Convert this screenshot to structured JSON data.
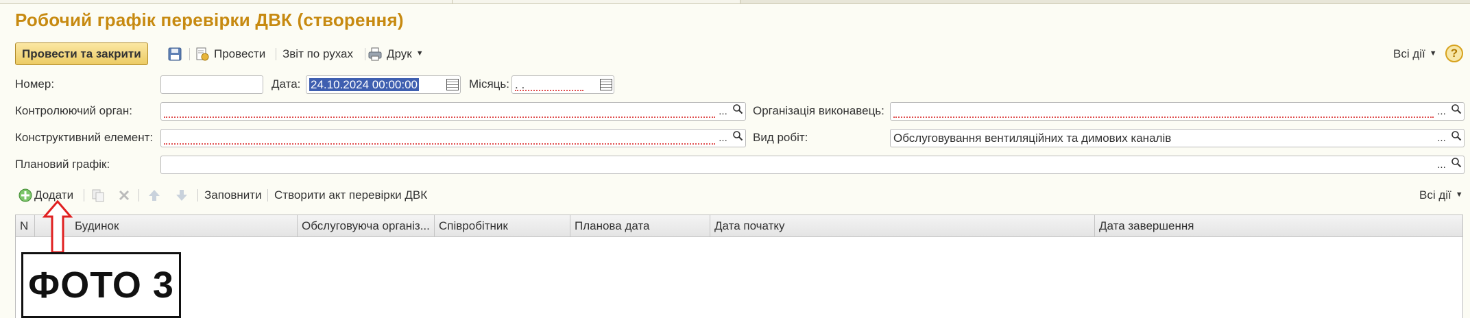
{
  "window": {
    "title": "Робочий графік перевірки ДВК (створення)"
  },
  "toolbar": {
    "post_close_label": "Провести та закрити",
    "save_icon": "floppy-icon",
    "post_label": "Провести",
    "report_label": "Звіт по рухах",
    "print_label": "Друк",
    "all_actions_label": "Всі дії",
    "help_label": "?"
  },
  "form": {
    "number_label": "Номер:",
    "number_value": "",
    "date_label": "Дата:",
    "date_value": "24.10.2024 00:00:00",
    "month_label": "Місяць:",
    "month_value": "  .  .",
    "control_body_label": "Контролюючий орган:",
    "control_body_value": "",
    "executor_org_label": "Організація виконавець:",
    "executor_org_value": "",
    "constructive_element_label": "Конструктивний елемент:",
    "constructive_element_value": "",
    "work_type_label": "Вид робіт:",
    "work_type_value": "Обслуговування вентиляційних та димових каналів",
    "planned_schedule_label": "Плановий графік:",
    "planned_schedule_value": "",
    "select_button": "...",
    "search_icon": "magnifier-icon"
  },
  "table_toolbar": {
    "add_label": "Додати",
    "fill_label": "Заповнити",
    "create_act_label": "Створити акт перевірки ДВК",
    "all_actions_label": "Всі дії"
  },
  "table": {
    "columns": [
      "N",
      "Будинок",
      "Обслуговуюча організ...",
      "Співробітник",
      "Планова дата",
      "Дата початку",
      "Дата завершення"
    ],
    "rows": []
  },
  "annotation": {
    "label": "ФОТО 3",
    "arrow_color": "#e02020"
  },
  "colors": {
    "title": "#c78a11",
    "primary_button": "#eccb64",
    "selection": "#3f5fb0",
    "required_underline": "#e05050"
  }
}
